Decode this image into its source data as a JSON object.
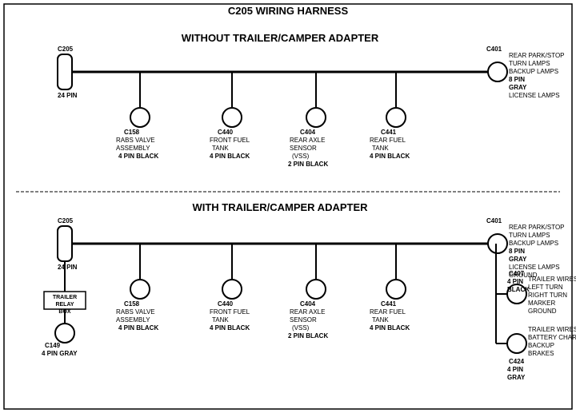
{
  "page": {
    "title": "C205 WIRING HARNESS",
    "background": "#ffffff"
  },
  "top_section": {
    "title": "WITHOUT  TRAILER/CAMPER  ADAPTER",
    "left_connector": {
      "id": "C205",
      "pins": "24 PIN",
      "type": "rectangle"
    },
    "right_connector": {
      "id": "C401",
      "pins": "8 PIN",
      "color": "GRAY",
      "functions": [
        "REAR PARK/STOP",
        "TURN LAMPS",
        "BACKUP LAMPS",
        "LICENSE LAMPS"
      ]
    },
    "branch_connectors": [
      {
        "id": "C158",
        "desc": [
          "RABS VALVE",
          "ASSEMBLY"
        ],
        "pins": "4 PIN BLACK"
      },
      {
        "id": "C440",
        "desc": [
          "FRONT FUEL",
          "TANK"
        ],
        "pins": "4 PIN BLACK"
      },
      {
        "id": "C404",
        "desc": [
          "REAR AXLE",
          "SENSOR",
          "(VSS)"
        ],
        "pins": "2 PIN BLACK"
      },
      {
        "id": "C441",
        "desc": [
          "REAR FUEL",
          "TANK"
        ],
        "pins": "4 PIN BLACK"
      }
    ]
  },
  "bottom_section": {
    "title": "WITH  TRAILER/CAMPER  ADAPTER",
    "left_connector": {
      "id": "C205",
      "pins": "24 PIN",
      "type": "rectangle"
    },
    "trailer_relay_box": {
      "label": "TRAILER RELAY BOX"
    },
    "c149": {
      "id": "C149",
      "pins": "4 PIN GRAY"
    },
    "right_connector": {
      "id": "C401",
      "pins": "8 PIN",
      "color": "GRAY",
      "functions": [
        "REAR PARK/STOP",
        "TURN LAMPS",
        "BACKUP LAMPS",
        "LICENSE LAMPS",
        "GROUND"
      ]
    },
    "branch_connectors": [
      {
        "id": "C158",
        "desc": [
          "RABS VALVE",
          "ASSEMBLY"
        ],
        "pins": "4 PIN BLACK"
      },
      {
        "id": "C440",
        "desc": [
          "FRONT FUEL",
          "TANK"
        ],
        "pins": "4 PIN BLACK"
      },
      {
        "id": "C404",
        "desc": [
          "REAR AXLE",
          "SENSOR",
          "(VSS)"
        ],
        "pins": "2 PIN BLACK"
      },
      {
        "id": "C441",
        "desc": [
          "REAR FUEL",
          "TANK"
        ],
        "pins": "4 PIN BLACK"
      }
    ],
    "right_branches": [
      {
        "id": "C407",
        "pins": "4 PIN",
        "color": "BLACK",
        "functions": [
          "TRAILER WIRES",
          "LEFT TURN",
          "RIGHT TURN",
          "MARKER",
          "GROUND"
        ]
      },
      {
        "id": "C424",
        "pins": "4 PIN",
        "color": "GRAY",
        "functions": [
          "TRAILER WIRES",
          "BATTERY CHARGE",
          "BACKUP",
          "BRAKES"
        ]
      }
    ]
  }
}
